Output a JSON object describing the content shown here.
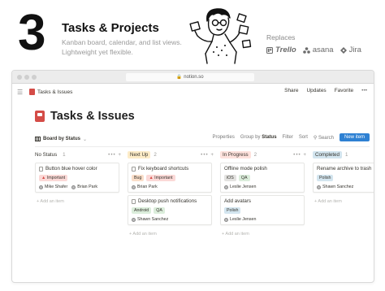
{
  "hero": {
    "number": "3",
    "title": "Tasks & Projects",
    "subtitle": "Kanban board, calendar, and list views. Lightweight yet flexible.",
    "replaces_label": "Replaces",
    "brands": [
      "Trello",
      "asana",
      "Jira"
    ]
  },
  "browser": {
    "url": "notion.so"
  },
  "topbar": {
    "breadcrumb": "Tasks & Issues",
    "actions": [
      "Share",
      "Updates",
      "Favorite",
      "•••"
    ]
  },
  "page": {
    "title": "Tasks & Issues"
  },
  "viewbar": {
    "view_name": "Board by Status",
    "properties": "Properties",
    "group_by_prefix": "Group by",
    "group_by_value": "Status",
    "filter": "Filter",
    "sort": "Sort",
    "search": "Search",
    "new_item": "New item"
  },
  "board": {
    "add_new_label": "+ Add an item",
    "tools_label": "•••  +",
    "columns": [
      {
        "status": "No Status",
        "count": "1",
        "color": "#ffffff",
        "cards": [
          {
            "title": "Button blue hover color",
            "tags": [
              {
                "label": "Important",
                "color": "#fbd9d7",
                "icon": "fire-icon"
              }
            ],
            "people": [
              "Mike Shafer",
              "Brian Park"
            ]
          }
        ]
      },
      {
        "status": "Next Up",
        "count": "2",
        "color": "#fdecc8",
        "cards": [
          {
            "title": "Fix keyboard shortcuts",
            "tags": [
              {
                "label": "Bug",
                "color": "#fadec9"
              },
              {
                "label": "Important",
                "color": "#fbd9d7",
                "icon": "fire-icon"
              }
            ],
            "people": [
              "Brian Park"
            ]
          },
          {
            "title": "Desktop push notifications",
            "tags": [
              {
                "label": "Android",
                "color": "#dbeddb"
              },
              {
                "label": "QA",
                "color": "#dbeddb"
              }
            ],
            "people": [
              "Shawn Sanchez"
            ]
          }
        ]
      },
      {
        "status": "In Progress",
        "count": "2",
        "color": "#ffe2dd",
        "cards": [
          {
            "title": "Offline mode polish",
            "tags": [
              {
                "label": "iOS",
                "color": "#e3e2e0"
              },
              {
                "label": "QA",
                "color": "#dbeddb"
              }
            ],
            "people": [
              "Leslie Jensen"
            ]
          },
          {
            "title": "Add avatars",
            "tags": [
              {
                "label": "Polish",
                "color": "#d3e5ef"
              }
            ],
            "people": [
              "Leslie Jensen"
            ]
          }
        ]
      },
      {
        "status": "Completed",
        "count": "1",
        "color": "#d3e5ef",
        "cards": [
          {
            "title": "Rename archive to trash",
            "tags": [
              {
                "label": "Polish",
                "color": "#d3e5ef"
              }
            ],
            "people": [
              "Shawn Sanchez"
            ]
          }
        ]
      }
    ]
  }
}
